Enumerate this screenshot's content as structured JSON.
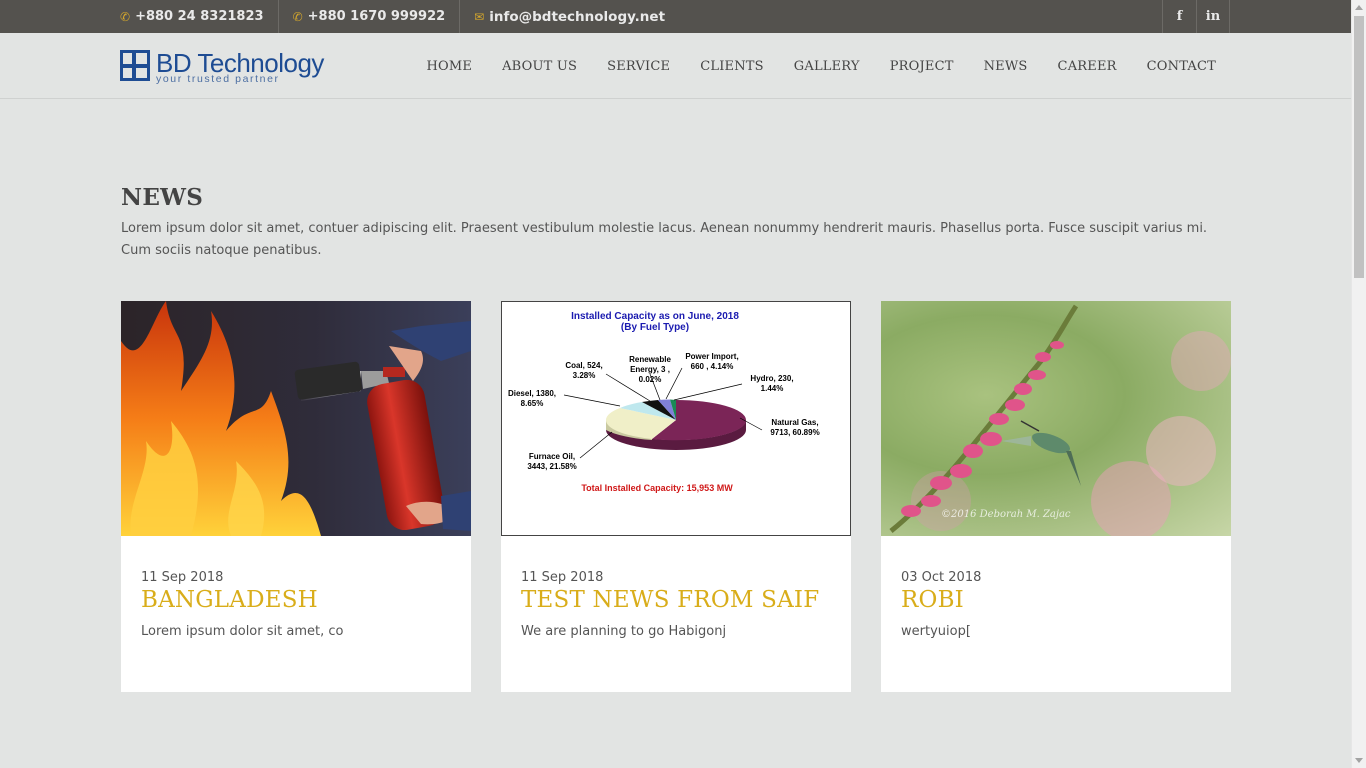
{
  "topbar": {
    "phone1": "+880 24 8321823",
    "phone2": "+880 1670 999922",
    "email": "info@bdtechnology.net",
    "social": [
      "f",
      "in"
    ]
  },
  "brand": {
    "name": "BD Technology",
    "tagline": "your trusted partner",
    "color": "#1e4c93"
  },
  "nav": [
    "HOME",
    "ABOUT US",
    "SERVICE",
    "CLIENTS",
    "GALLERY",
    "PROJECT",
    "NEWS",
    "CAREER",
    "CONTACT"
  ],
  "news": {
    "title": "NEWS",
    "intro": "Lorem ipsum dolor sit amet, contuer adipiscing elit. Praesent vestibulum molestie lacus. Aenean nonummy hendrerit mauris. Phasellus porta. Fusce suscipit varius mi. Cum sociis natoque penatibus.",
    "cards": [
      {
        "date": "11 Sep 2018",
        "title": "BANGLADESH",
        "excerpt": "Lorem ipsum dolor sit amet, co"
      },
      {
        "date": "11 Sep 2018",
        "title": "TEST NEWS FROM SAIF",
        "excerpt": "We are planning to go Habigonj"
      },
      {
        "date": "03 Oct 2018",
        "title": "ROBI",
        "excerpt": "wertyuiop["
      }
    ]
  },
  "chart_image": {
    "title1": "Installed Capacity as on June, 2018",
    "title2": "(By Fuel Type)",
    "total": "Total Installed Capacity: 15,953 MW",
    "labels": [
      [
        "Coal, 524,",
        "3.28%"
      ],
      [
        "Renewable",
        "Energy, 3 ,",
        "0.02%"
      ],
      [
        "Power Import,",
        "660 , 4.14%"
      ],
      [
        "Hydro, 230,",
        "1.44%"
      ],
      [
        "Diesel, 1380,",
        "8.65%"
      ],
      [
        "Natural Gas,",
        "9713, 60.89%"
      ],
      [
        "Furnace Oil,",
        "3443, 21.58%"
      ]
    ]
  },
  "photo_watermark": "©2016 Deborah M. Zajac",
  "colors": {
    "accent": "#d9ad1a",
    "topbar": "#54524e",
    "icon": "#d4a72c"
  }
}
